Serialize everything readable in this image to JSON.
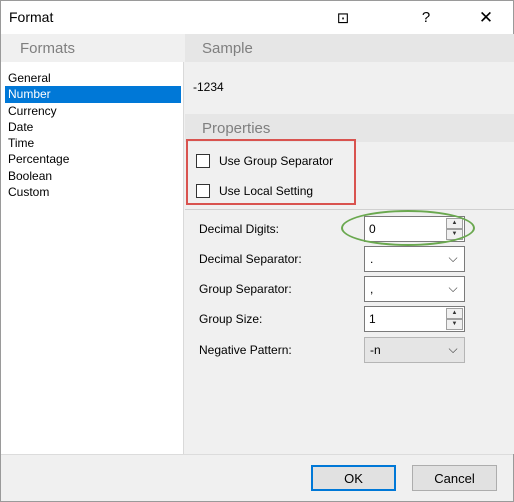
{
  "window": {
    "title": "Format",
    "help_label": "?",
    "close_label": "✕",
    "pin_label": "⊡"
  },
  "formats": {
    "header": "Formats",
    "items": [
      "General",
      "Number",
      "Currency",
      "Date",
      "Time",
      "Percentage",
      "Boolean",
      "Custom"
    ],
    "selected": "Number"
  },
  "sample": {
    "header": "Sample",
    "value": "-1234"
  },
  "properties": {
    "header": "Properties",
    "use_group_separator": {
      "label": "Use Group Separator",
      "checked": false
    },
    "use_local_setting": {
      "label": "Use Local Setting",
      "checked": false
    },
    "decimal_digits": {
      "label": "Decimal Digits:",
      "value": "0"
    },
    "decimal_separator": {
      "label": "Decimal Separator:",
      "value": "."
    },
    "group_separator": {
      "label": "Group Separator:",
      "value": ","
    },
    "group_size": {
      "label": "Group Size:",
      "value": "1"
    },
    "negative_pattern": {
      "label": "Negative Pattern:",
      "value": "-n"
    }
  },
  "footer": {
    "ok_label": "OK",
    "cancel_label": "Cancel"
  },
  "colors": {
    "selection": "#0078d7",
    "highlight_red": "#d9534f",
    "highlight_green": "#6aa84f"
  }
}
